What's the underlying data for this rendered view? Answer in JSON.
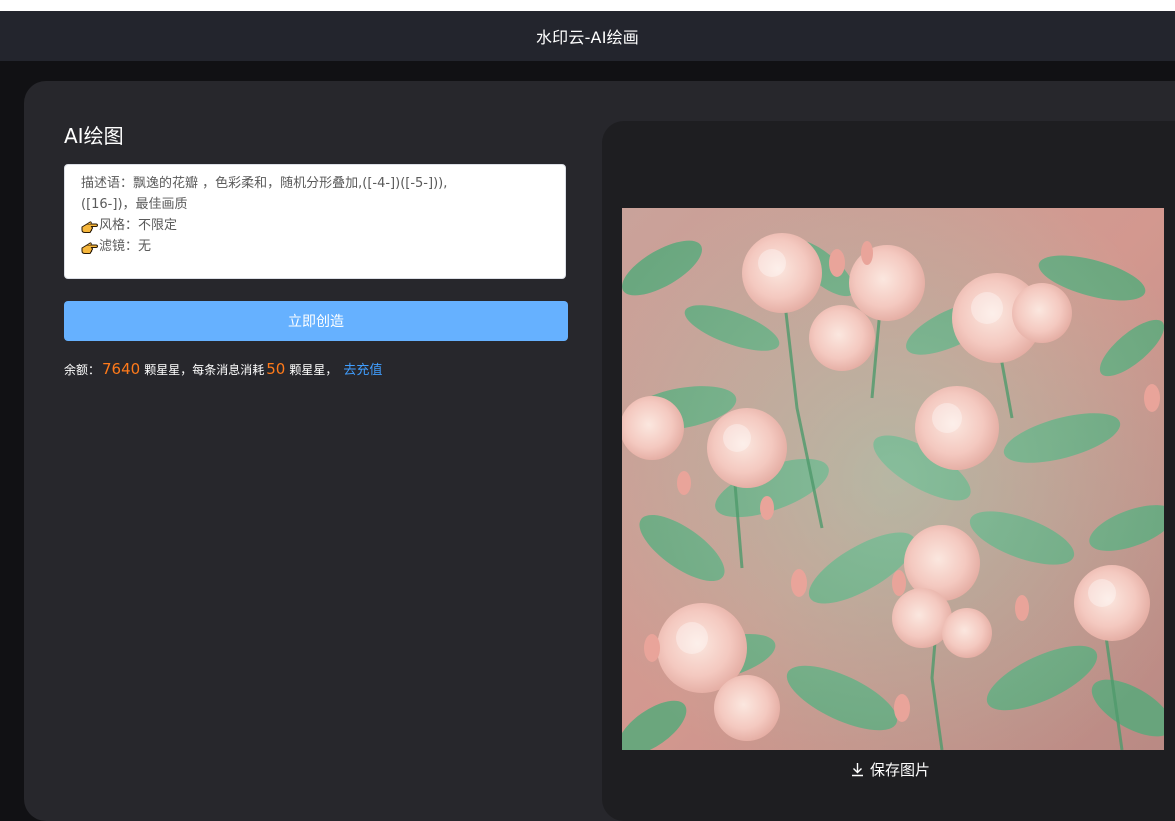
{
  "header": {
    "title": "水印云-AI绘画"
  },
  "panel": {
    "title": "AI绘图",
    "prompt": {
      "description_line1": "描述语：飘逸的花瓣 ，色彩柔和，随机分形叠加,([-4-])([-5-])),",
      "description_line2": "([16-])，最佳画质",
      "style_line": "风格：不限定",
      "filter_line": "滤镜：无",
      "icon": "pointing-hand-icon"
    },
    "create_button": "立即创造",
    "balance": {
      "label": "余额：",
      "amount": "7640",
      "unit1": "颗星星，每条消息消耗",
      "cost": "50",
      "unit2": "颗星星，",
      "recharge_link": "去充值"
    }
  },
  "result": {
    "image_alt": "AI生成的粉色玫瑰花图像",
    "save_button": "保存图片",
    "save_icon": "download-icon"
  },
  "colors": {
    "accent_button": "#66b1ff",
    "number_highlight": "#ff7a1a",
    "link": "#409eff",
    "background": "#111114",
    "card": "#27272c"
  }
}
